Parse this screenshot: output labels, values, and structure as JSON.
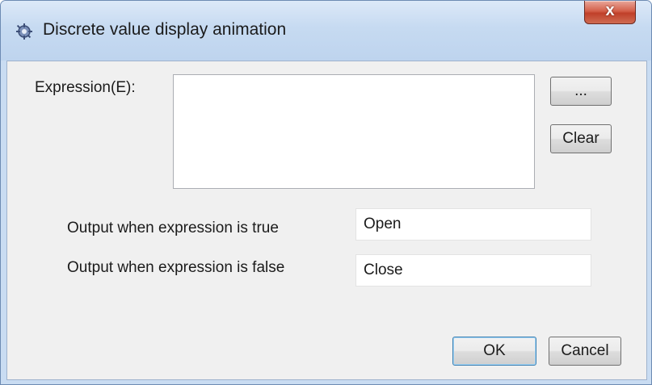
{
  "window": {
    "title": "Discrete value display animation",
    "close_glyph": "x"
  },
  "form": {
    "expression_label": "Expression(E):",
    "expression_value": "",
    "browse_button_label": "...",
    "clear_button_label": "Clear",
    "true_label": "Output when expression is true",
    "true_value": "Open",
    "false_label": "Output when expression is false",
    "false_value": "Close"
  },
  "footer": {
    "ok_label": "OK",
    "cancel_label": "Cancel"
  },
  "icons": {
    "title_icon": "app-gear-icon",
    "close_icon": "close-icon"
  },
  "colors": {
    "title_bar": "#c6daf1",
    "close_button": "#c9503a",
    "client_background": "#f0f0f0",
    "default_button_border": "#3c7fb1"
  }
}
